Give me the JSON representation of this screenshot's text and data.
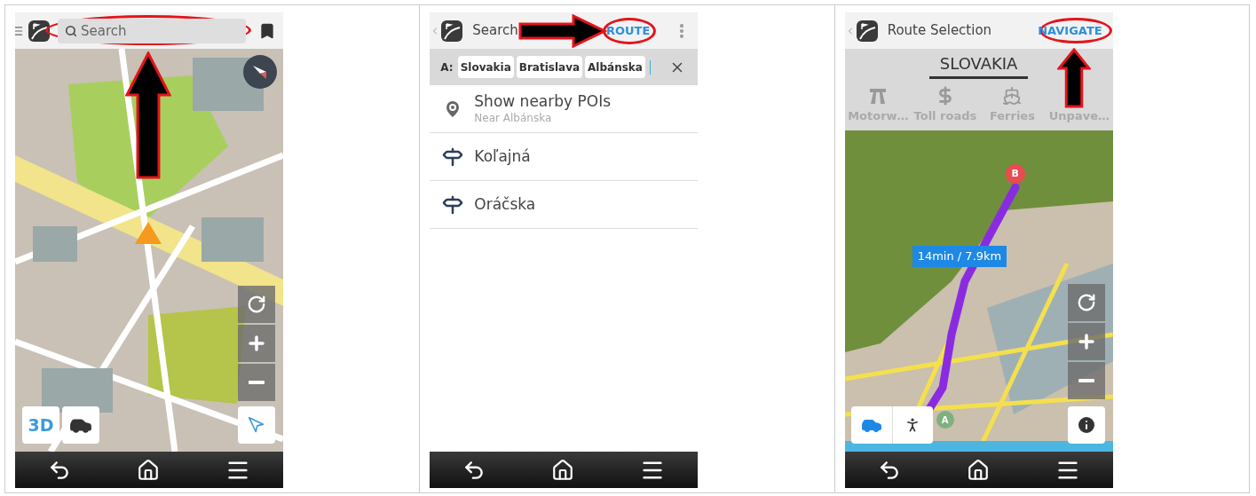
{
  "screens": [
    {
      "kind": "map",
      "search": {
        "placeholder": "Search"
      },
      "view_button": "3D"
    },
    {
      "kind": "search",
      "title": "Search",
      "action": "ROUTE",
      "route_bar": {
        "label": "A:",
        "chips": [
          "Slovakia",
          "Bratislava",
          "Albánska"
        ]
      },
      "results": [
        {
          "kind": "poi",
          "title": "Show nearby POIs",
          "subtitle": "Near Albánska"
        },
        {
          "kind": "street",
          "title": "Koľajná"
        },
        {
          "kind": "street",
          "title": "Oráčska"
        }
      ]
    },
    {
      "kind": "route",
      "title": "Route Selection",
      "action": "NAVIGATE",
      "country_tab": "SLOVAKIA",
      "avoid_options": [
        {
          "kind": "motorway",
          "label": "Motorw…"
        },
        {
          "kind": "toll",
          "label": "Toll roads"
        },
        {
          "kind": "ferry",
          "label": "Ferries"
        },
        {
          "kind": "unpaved",
          "label": "Unpave…"
        }
      ],
      "route_label": "14min / 7.9km",
      "destination_marker": "B",
      "origin_marker": "A",
      "modes": [
        {
          "kind": "car",
          "selected": true
        },
        {
          "kind": "walk",
          "selected": false
        }
      ]
    }
  ]
}
